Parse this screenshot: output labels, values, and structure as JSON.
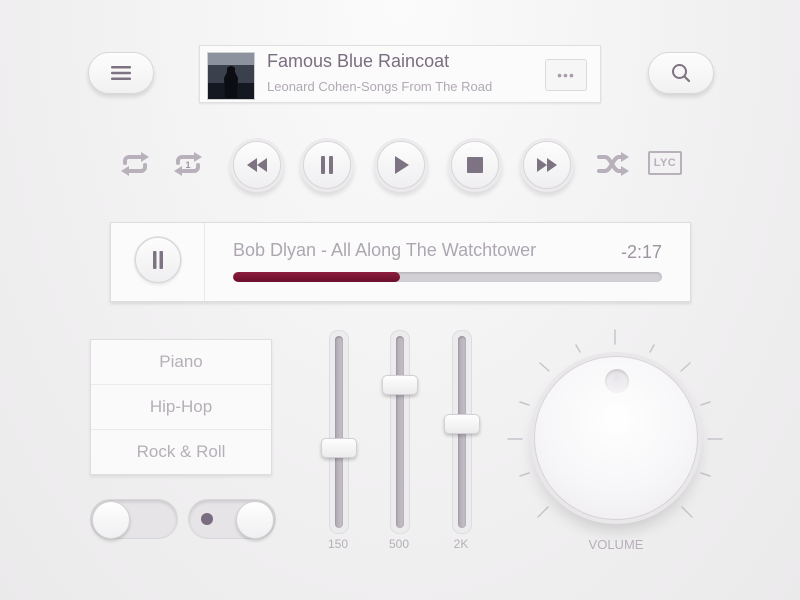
{
  "now_playing": {
    "title": "Famous Blue Raincoat",
    "artist": "Leonard Cohen-Songs From The Road",
    "more_label": "•••"
  },
  "controls": {
    "lyrics_label": "LYC",
    "repeat_one_badge": "1"
  },
  "player": {
    "track": "Bob Dlyan - All Along The Watchtower",
    "time_remaining": "-2:17",
    "progress": 0.39
  },
  "genres": [
    "Piano",
    "Hip-Hop",
    "Rock & Roll"
  ],
  "toggles": [
    {
      "on": false
    },
    {
      "on": true
    }
  ],
  "equalizer": {
    "bands": [
      {
        "label": "150",
        "level": 0.42
      },
      {
        "label": "500",
        "level": 0.76
      },
      {
        "label": "2K",
        "level": 0.55
      }
    ]
  },
  "volume": {
    "label": "VOLUME"
  },
  "colors": {
    "accent": "#7a1735",
    "icon": "#7d7382",
    "icon_light": "#b8b0bb"
  }
}
